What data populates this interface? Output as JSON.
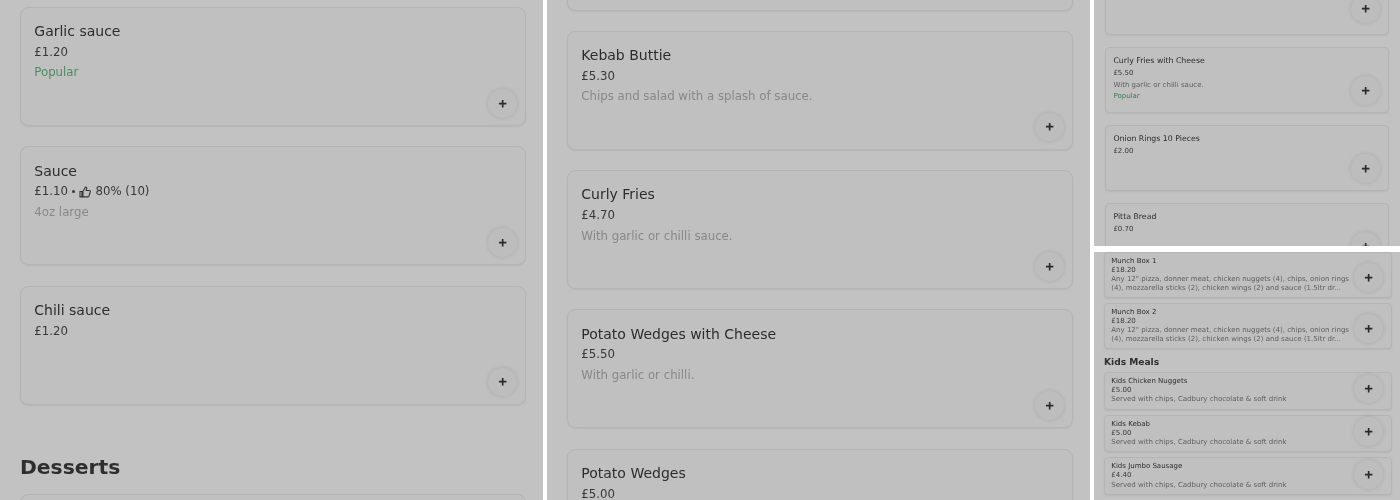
{
  "panels": [
    {
      "items": [
        {
          "kind": "card",
          "title": "Garlic sauce",
          "price": "£1.20",
          "badge": "Popular"
        },
        {
          "kind": "card",
          "title": "Sauce",
          "price": "£1.10",
          "rating": "80% (10)",
          "description": "4oz large"
        },
        {
          "kind": "card",
          "title": "Chili sauce",
          "price": "£1.20"
        },
        {
          "kind": "heading",
          "text": "Desserts"
        },
        {
          "kind": "card-start"
        }
      ]
    },
    {
      "items": [
        {
          "kind": "card-end"
        },
        {
          "kind": "card",
          "title": "Kebab Buttie",
          "price": "£5.30",
          "description": "Chips and salad with a splash of sauce."
        },
        {
          "kind": "card",
          "title": "Curly Fries",
          "price": "£4.70",
          "description": "With garlic or chilli sauce."
        },
        {
          "kind": "card",
          "title": "Potato Wedges with Cheese",
          "price": "£5.50",
          "description": "With garlic or chilli."
        },
        {
          "kind": "card",
          "title": "Potato Wedges",
          "price": "£5.00"
        }
      ]
    },
    {
      "items": [
        {
          "kind": "card-end",
          "plus": true
        },
        {
          "kind": "card",
          "title": "Curly Fries with Cheese",
          "price": "£5.50",
          "description": "With garlic or chilli sauce.",
          "badge": "Popular"
        },
        {
          "kind": "card",
          "title": "Onion Rings 10 Pieces",
          "price": "£2.00"
        },
        {
          "kind": "card",
          "title": "Pitta Bread",
          "price": "£0.70"
        }
      ]
    },
    {
      "items": [
        {
          "kind": "card",
          "title": "Munch Box 1",
          "price": "£18.20",
          "description": "Any 12\" pizza, donner meat, chicken nuggets (4), chips, onion rings (4), mozzarella sticks (2), chicken wings (2) and sauce (1.5ltr dr..."
        },
        {
          "kind": "card",
          "title": "Munch Box 2",
          "price": "£18.20",
          "description": "Any 12\" pizza, donner meat, chicken nuggets (4), chips, onion rings (4), mozzarella sticks (2), chicken wings (2) and sauce (1.5ltr dr..."
        },
        {
          "kind": "heading",
          "text": "Kids Meals"
        },
        {
          "kind": "card",
          "title": "Kids Chicken Nuggets",
          "price": "£5.00",
          "description": "Served with chips, Cadbury chocolate & soft drink"
        },
        {
          "kind": "card",
          "title": "Kids Kebab",
          "price": "£5.00",
          "description": "Served with chips, Cadbury chocolate & soft drink"
        },
        {
          "kind": "card",
          "title": "Kids Jumbo Sausage",
          "price": "£4.40",
          "description": "Served with chips, Cadbury chocolate & soft drink"
        }
      ]
    }
  ]
}
